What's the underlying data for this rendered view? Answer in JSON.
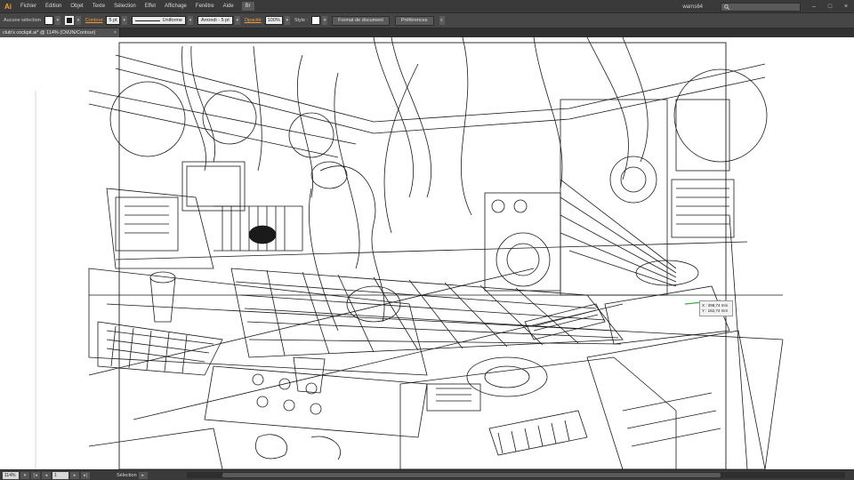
{
  "app": {
    "logo": "Ai",
    "menu": [
      "Fichier",
      "Edition",
      "Objet",
      "Texte",
      "Sélection",
      "Effet",
      "Affichage",
      "Fenêtre",
      "Aide"
    ],
    "menu_icon": "Br",
    "user": "warns64",
    "close_glyph": "×",
    "minimize_glyph": "–",
    "maximize_glyph": "□"
  },
  "control": {
    "selection_label": "Aucune sélection",
    "contour_label": "Contour",
    "contour_value": "5 pt",
    "stroke_style": "Uniforme",
    "brush": "Arrondi - 5 pt",
    "opacity_label": "Opacité",
    "opacity_value": "100%",
    "style_label": "Style :",
    "doc_format_btn": "Format de document",
    "prefs_btn": "Préférences"
  },
  "document": {
    "tab_title": "club's cockpit.ai* @ 114% (CMJN/Contour)",
    "close_glyph": "×"
  },
  "readout": {
    "x": "X : 398,74 mm",
    "y": "Y : 182,74 mm"
  },
  "status": {
    "zoom": "114%",
    "page": "1",
    "tool": "Sélection"
  },
  "colors": {
    "accent": "#f7a21b",
    "canvas": "#ffffff",
    "ui_dark": "#3a3a3a"
  },
  "icons": {
    "search": "search-icon",
    "fill": "fill-swatch-icon",
    "stroke": "stroke-swatch-icon"
  }
}
